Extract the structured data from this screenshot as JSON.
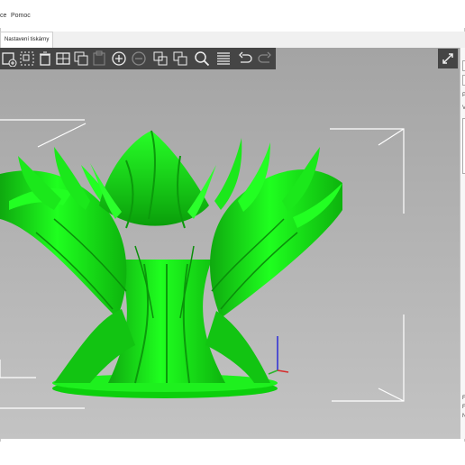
{
  "menu": {
    "item_partial": "ce",
    "help": "Pomoc"
  },
  "tabs": {
    "printer_settings": "Nastavení tiskárny"
  },
  "toolbar": {
    "icons": [
      "add-object-icon",
      "arrange-icon",
      "delete-icon",
      "layout-icon",
      "copy-icon",
      "paste-icon",
      "add-instance-icon",
      "remove-instance-icon",
      "split-objects-icon",
      "split-parts-icon",
      "search-icon",
      "layers-editor-icon",
      "undo-icon",
      "redo-icon"
    ]
  },
  "colors": {
    "model": "#0ae60a",
    "toolbar": "#454545",
    "viewport_top": "#a4a4a4",
    "viewport_bottom": "#c3c3c3"
  },
  "right_panel": {
    "fragment_a": "P",
    "fragment_b": "V",
    "fragment_c": "F",
    "fragment_d": "F",
    "fragment_e": "N"
  }
}
